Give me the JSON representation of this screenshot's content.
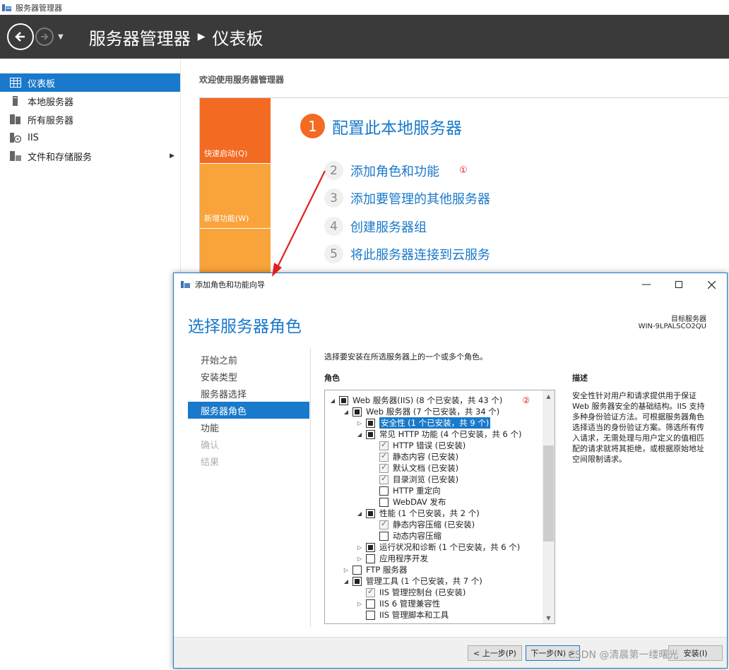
{
  "window": {
    "title": "服务器管理器"
  },
  "header": {
    "app": "服务器管理器",
    "page": "仪表板"
  },
  "sidebar": {
    "items": [
      {
        "label": "仪表板",
        "icon": "dashboard-icon",
        "active": true
      },
      {
        "label": "本地服务器",
        "icon": "server-icon"
      },
      {
        "label": "所有服务器",
        "icon": "servers-icon"
      },
      {
        "label": "IIS",
        "icon": "iis-icon"
      },
      {
        "label": "文件和存储服务",
        "icon": "storage-icon",
        "has_children": true
      }
    ]
  },
  "main": {
    "welcome": "欢迎使用服务器管理器",
    "tiles": [
      "快速启动(Q)",
      "新增功能(W)"
    ],
    "steps": [
      {
        "num": "1",
        "label": "配置此本地服务器"
      },
      {
        "num": "2",
        "label": "添加角色和功能",
        "annotation": "①"
      },
      {
        "num": "3",
        "label": "添加要管理的其他服务器"
      },
      {
        "num": "4",
        "label": "创建服务器组"
      },
      {
        "num": "5",
        "label": "将此服务器连接到云服务"
      }
    ]
  },
  "dialog": {
    "title": "添加角色和功能向导",
    "heading": "选择服务器角色",
    "destination_label": "目标服务器",
    "destination_name": "WIN-9LPALSCO2QU",
    "nav": [
      {
        "label": "开始之前",
        "state": "normal"
      },
      {
        "label": "安装类型",
        "state": "normal"
      },
      {
        "label": "服务器选择",
        "state": "normal"
      },
      {
        "label": "服务器角色",
        "state": "active"
      },
      {
        "label": "功能",
        "state": "normal"
      },
      {
        "label": "确认",
        "state": "disabled"
      },
      {
        "label": "结果",
        "state": "disabled"
      }
    ],
    "instruction": "选择要安装在所选服务器上的一个或多个角色。",
    "roles_label": "角色",
    "description_label": "描述",
    "description": "安全性针对用户和请求提供用于保证 Web 服务器安全的基础结构。IIS 支持多种身份验证方法。可根据服务器角色选择适当的身份验证方案。筛选所有传入请求，无需处理与用户定义的值相匹配的请求就将其拒绝，或根据原始地址空间限制请求。",
    "tree": [
      {
        "level": 0,
        "expander": "◢",
        "check": "partial",
        "label": "Web 服务器(IIS) (8 个已安装，共 43 个)",
        "annotation": "②"
      },
      {
        "level": 1,
        "expander": "◢",
        "check": "partial",
        "label": "Web 服务器 (7 个已安装，共 34 个)"
      },
      {
        "level": 2,
        "expander": "▷",
        "check": "partial",
        "label": "安全性 (1 个已安装，共 9 个)",
        "selected": true
      },
      {
        "level": 2,
        "expander": "◢",
        "check": "partial",
        "label": "常见 HTTP 功能 (4 个已安装，共 6 个)"
      },
      {
        "level": 3,
        "expander": "",
        "check": "checked",
        "label": "HTTP 错误 (已安装)"
      },
      {
        "level": 3,
        "expander": "",
        "check": "checked",
        "label": "静态内容 (已安装)"
      },
      {
        "level": 3,
        "expander": "",
        "check": "checked",
        "label": "默认文档 (已安装)"
      },
      {
        "level": 3,
        "expander": "",
        "check": "checked",
        "label": "目录浏览 (已安装)"
      },
      {
        "level": 3,
        "expander": "",
        "check": "empty",
        "label": "HTTP 重定向"
      },
      {
        "level": 3,
        "expander": "",
        "check": "empty",
        "label": "WebDAV 发布"
      },
      {
        "level": 2,
        "expander": "◢",
        "check": "partial",
        "label": "性能 (1 个已安装，共 2 个)"
      },
      {
        "level": 3,
        "expander": "",
        "check": "checked",
        "label": "静态内容压缩 (已安装)"
      },
      {
        "level": 3,
        "expander": "",
        "check": "empty",
        "label": "动态内容压缩"
      },
      {
        "level": 2,
        "expander": "▷",
        "check": "partial",
        "label": "运行状况和诊断 (1 个已安装，共 6 个)"
      },
      {
        "level": 2,
        "expander": "▷",
        "check": "empty",
        "label": "应用程序开发"
      },
      {
        "level": 1,
        "expander": "▷",
        "check": "empty",
        "label": "FTP 服务器"
      },
      {
        "level": 1,
        "expander": "◢",
        "check": "partial",
        "label": "管理工具 (1 个已安装，共 7 个)"
      },
      {
        "level": 2,
        "expander": "",
        "check": "checked",
        "label": "IIS 管理控制台 (已安装)"
      },
      {
        "level": 2,
        "expander": "▷",
        "check": "empty",
        "label": "IIS 6 管理兼容性"
      },
      {
        "level": 2,
        "expander": "",
        "check": "empty",
        "label": "IIS 管理脚本和工具"
      }
    ],
    "buttons": {
      "prev": "< 上一步(P)",
      "next": "下一步(N) >",
      "install": "安装(I)"
    },
    "watermark": "CSDN @清晨第一缕曙光"
  },
  "colors": {
    "accent": "#1979ca",
    "header_bg": "#3a3a3a",
    "tile_orange": "#f36a22",
    "tile_amber": "#f9a33b",
    "annotation": "#e02020"
  }
}
